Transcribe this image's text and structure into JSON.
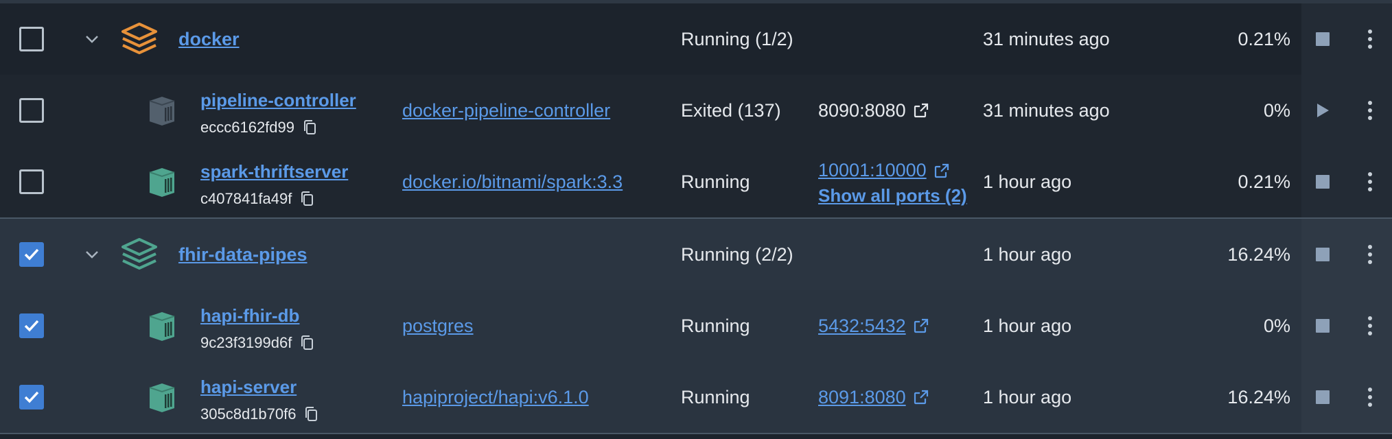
{
  "rows": [
    {
      "kind": "group",
      "name": "docker",
      "status": "Running (1/2)",
      "started": "31 minutes ago",
      "cpu": "0.21%",
      "checked": false,
      "icon_color": "#e8923a"
    },
    {
      "kind": "container",
      "name": "pipeline-controller",
      "id": "eccc6162fd99",
      "image": "docker-pipeline-controller",
      "status": "Exited (137)",
      "port": "8090:8080",
      "started": "31 minutes ago",
      "cpu": "0%",
      "checked": false,
      "icon_color": "#53606d"
    },
    {
      "kind": "container",
      "name": "spark-thriftserver",
      "id": "c407841fa49f",
      "image": "docker.io/bitnami/spark:3.3",
      "status": "Running",
      "port": "10001:10000",
      "show_all_ports": "Show all ports (2)",
      "started": "1 hour ago",
      "cpu": "0.21%",
      "checked": false,
      "icon_color": "#4fa58f"
    },
    {
      "kind": "group",
      "name": "fhir-data-pipes",
      "status": "Running (2/2)",
      "started": "1 hour ago",
      "cpu": "16.24%",
      "checked": true,
      "icon_color": "#4fa58f"
    },
    {
      "kind": "container",
      "name": "hapi-fhir-db",
      "id": "9c23f3199d6f",
      "image": "postgres",
      "status": "Running",
      "port": "5432:5432",
      "started": "1 hour ago",
      "cpu": "0%",
      "checked": true,
      "icon_color": "#4fa58f"
    },
    {
      "kind": "container",
      "name": "hapi-server",
      "id": "305c8d1b70f6",
      "image": "hapiproject/hapi:v6.1.0",
      "status": "Running",
      "port": "8091:8080",
      "started": "1 hour ago",
      "cpu": "16.24%",
      "checked": true,
      "icon_color": "#4fa58f"
    }
  ],
  "icons": {
    "group": "stack-layers-icon",
    "container": "container-cube-icon",
    "copy": "copy-icon",
    "external": "external-link-icon",
    "stop": "stop-icon",
    "play": "play-icon",
    "more": "more-vertical-icon",
    "expand": "chevron-down-icon",
    "check": "check-icon"
  },
  "colors": {
    "link": "#5b9ae8",
    "checkbox_on": "#3f7ed3",
    "stop": "#8ea1b8"
  }
}
